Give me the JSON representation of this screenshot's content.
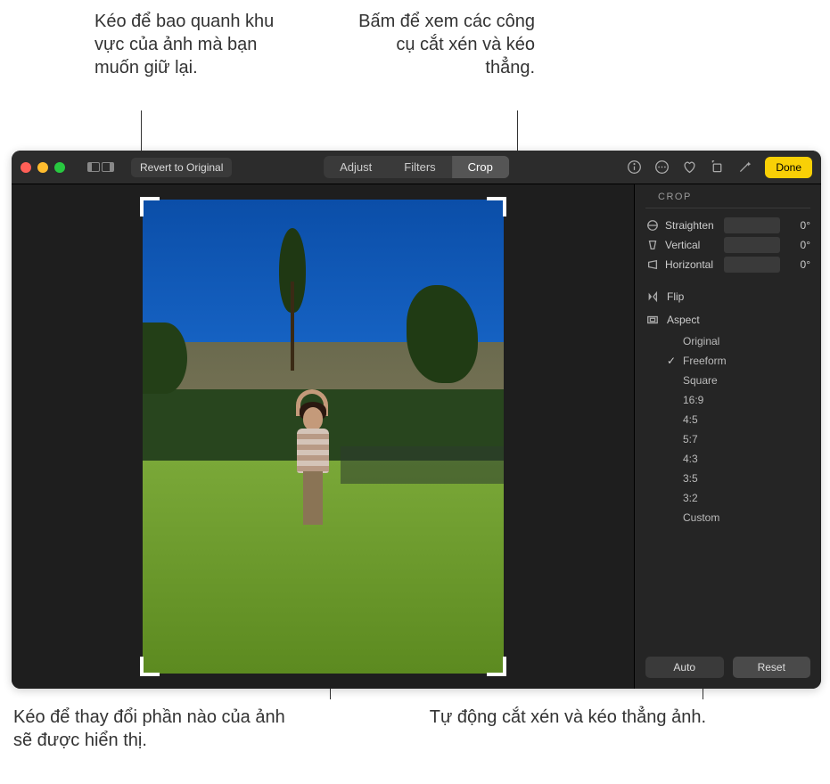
{
  "callouts": {
    "drag_corner": "Kéo để bao quanh khu vực của ảnh mà bạn muốn giữ lại.",
    "crop_click": "Bấm để xem các công cụ cắt xén và kéo thẳng.",
    "drag_reposition": "Kéo để thay đổi phần nào của ảnh sẽ được hiển thị.",
    "auto": "Tự động cắt xén và kéo thẳng ảnh."
  },
  "toolbar": {
    "revert": "Revert to Original",
    "adjust": "Adjust",
    "filters": "Filters",
    "crop": "Crop",
    "done": "Done"
  },
  "inspector": {
    "header": "CROP",
    "sliders": {
      "straighten": {
        "label": "Straighten",
        "value": "0°"
      },
      "vertical": {
        "label": "Vertical",
        "value": "0°"
      },
      "horizontal": {
        "label": "Horizontal",
        "value": "0°"
      }
    },
    "flip": "Flip",
    "aspect": "Aspect",
    "aspect_options": [
      "Original",
      "Freeform",
      "Square",
      "16:9",
      "4:5",
      "5:7",
      "4:3",
      "3:5",
      "3:2",
      "Custom"
    ],
    "aspect_selected": "Freeform",
    "auto": "Auto",
    "reset": "Reset"
  }
}
